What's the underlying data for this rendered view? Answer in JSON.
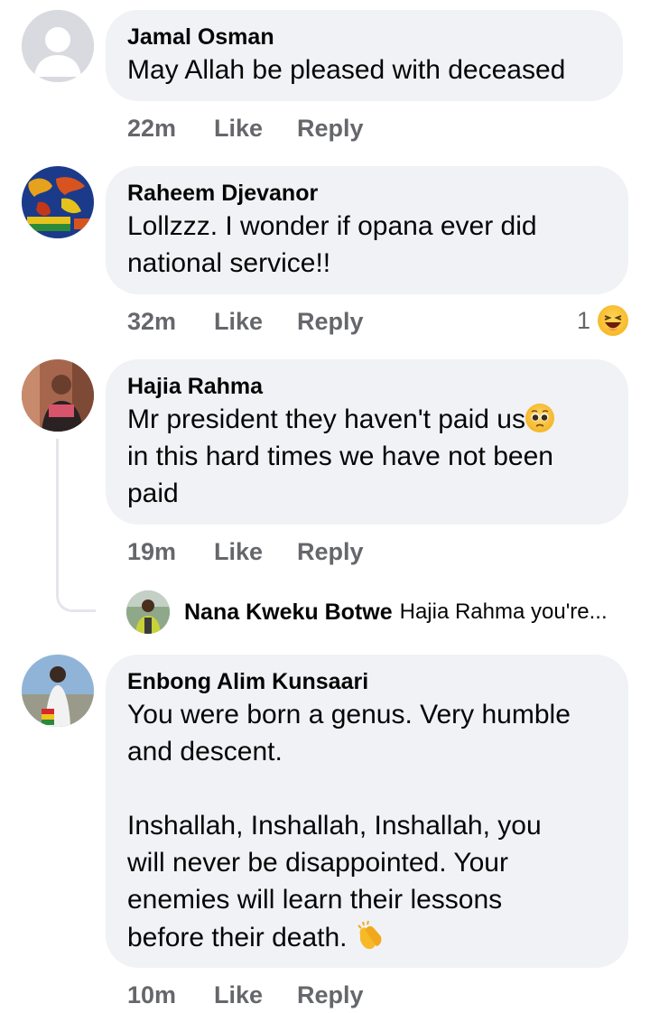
{
  "comments": [
    {
      "author": "Jamal Osman",
      "text": "May Allah be pleased with deceased",
      "time": "22m",
      "like": "Like",
      "reply": "Reply"
    },
    {
      "author": "Raheem Djevanor",
      "text": "Lollzzz. I wonder if opana ever did\nnational service!!",
      "time": "32m",
      "like": "Like",
      "reply": "Reply",
      "reaction_count": "1",
      "reaction_icon": "laughing-emoji-icon"
    },
    {
      "author": "Hajia Rahma",
      "text_line1": "Mr president they haven't paid us",
      "text_rest": "in this hard times we have not been\npaid",
      "inline_icon": "pleading-face-emoji-icon",
      "time": "19m",
      "like": "Like",
      "reply": "Reply",
      "reply_preview": {
        "author": "Nana Kweku Botwe",
        "text": "Hajia Rahma you're..."
      }
    },
    {
      "author": "Enbong Alim Kunsaari",
      "text": "You were born a genus. Very humble\nand descent.\n\nInshallah, Inshallah, Inshallah, you\nwill never be disappointed. Your\nenemies will learn their lessons\nbefore their death. ",
      "inline_icon": "clapping-hands-emoji-icon",
      "time": "10m",
      "like": "Like",
      "reply": "Reply"
    }
  ]
}
